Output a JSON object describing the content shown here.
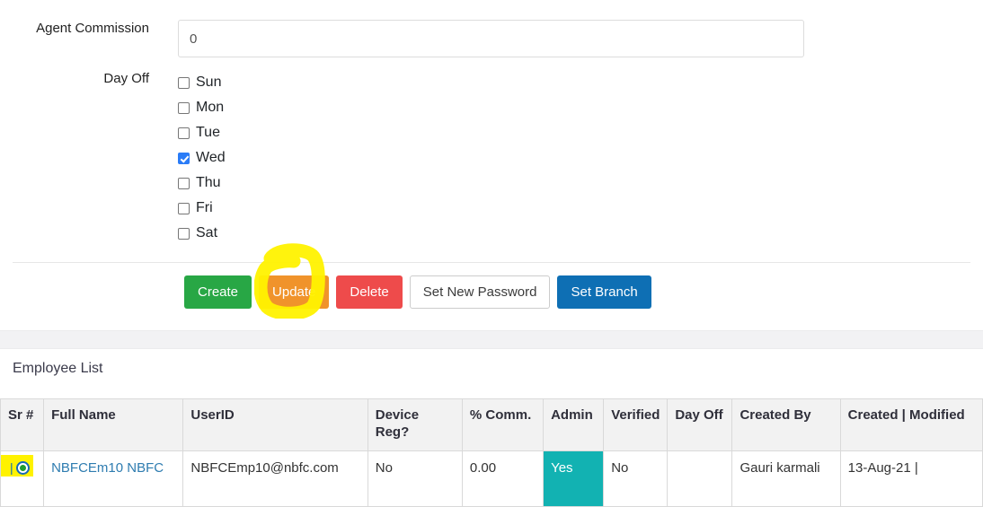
{
  "form": {
    "commission": {
      "label": "Agent Commission",
      "value": "0",
      "placeholder": ""
    },
    "day_off": {
      "label": "Day Off",
      "days": [
        {
          "label": "Sun",
          "checked": false
        },
        {
          "label": "Mon",
          "checked": false
        },
        {
          "label": "Tue",
          "checked": false
        },
        {
          "label": "Wed",
          "checked": true
        },
        {
          "label": "Thu",
          "checked": false
        },
        {
          "label": "Fri",
          "checked": false
        },
        {
          "label": "Sat",
          "checked": false
        }
      ]
    }
  },
  "buttons": {
    "create": "Create",
    "update": "Update",
    "delete": "Delete",
    "set_password": "Set New Password",
    "set_branch": "Set Branch"
  },
  "annotation": {
    "type": "marker-loop",
    "target": "Update",
    "color": "#fff200"
  },
  "employee_list": {
    "title": "Employee List",
    "columns": [
      "Sr #",
      "Full Name",
      "UserID",
      "Device Reg?",
      "% Comm.",
      "Admin",
      "Verified",
      "Day Off",
      "Created By",
      "Created | Modified"
    ],
    "rows": [
      {
        "selected": true,
        "full_name": "NBFCEm10 NBFC",
        "user_id": "NBFCEmp10@nbfc.com",
        "device_reg": "No",
        "commission": "0.00",
        "admin": "Yes",
        "verified": "No",
        "day_off": "",
        "created_by": "Gauri karmali",
        "created_modified": "13-Aug-21 |"
      }
    ]
  },
  "colors": {
    "create": "#28a745",
    "update": "#f0932b",
    "delete": "#ee4b4b",
    "set_branch": "#0e6fb4",
    "admin_badge": "#12b2b2",
    "highlight": "#fff200",
    "link": "#2e7cb0"
  }
}
